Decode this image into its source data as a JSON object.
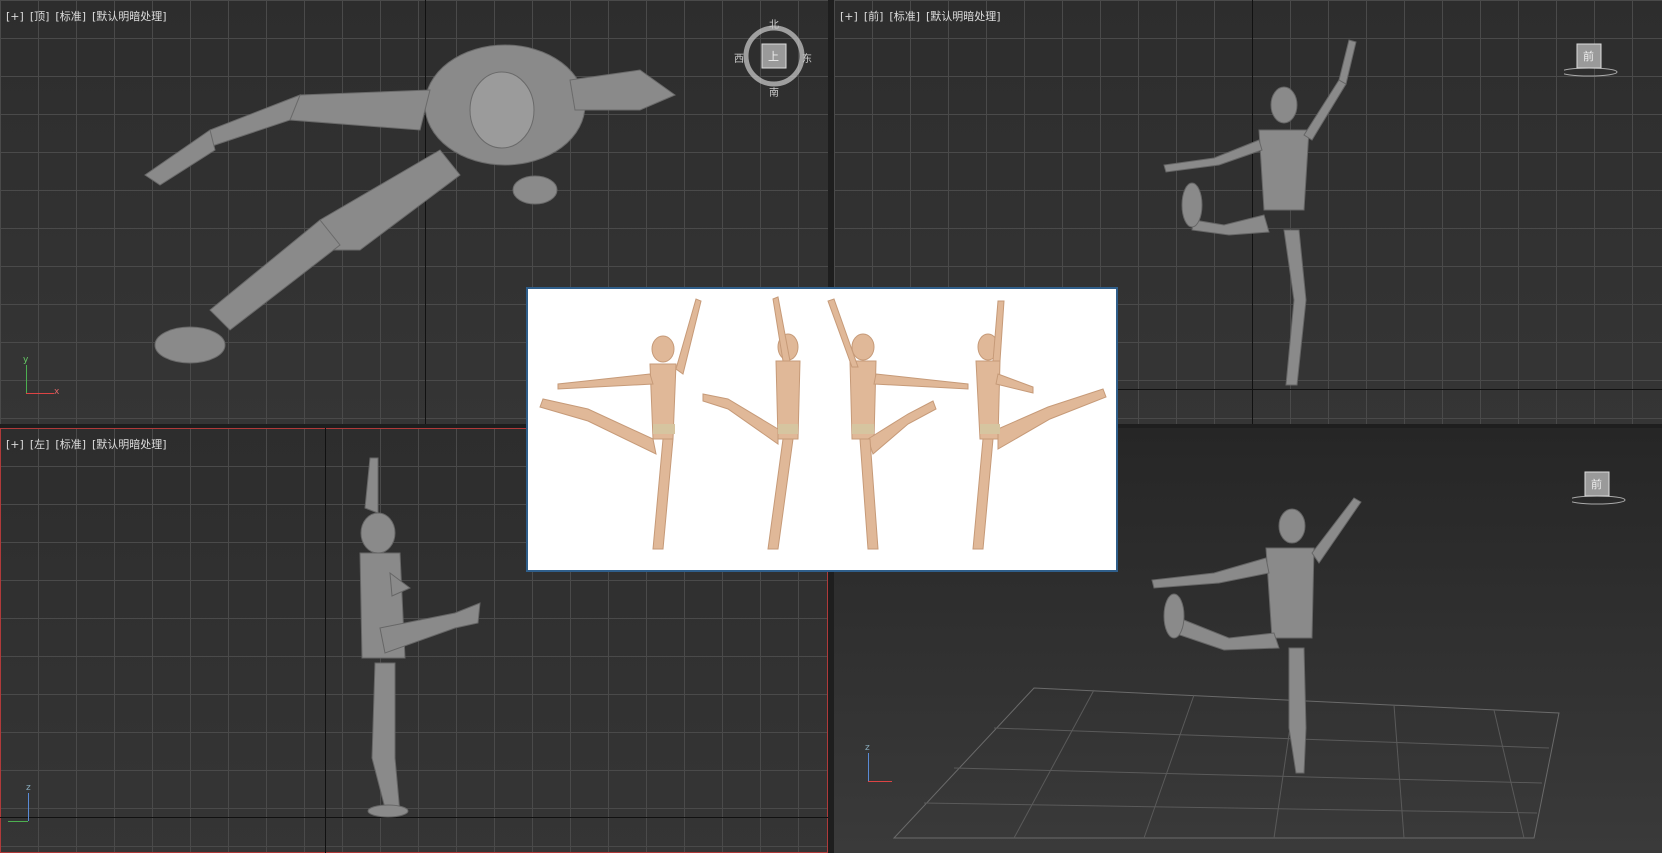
{
  "viewports": {
    "top": {
      "labels": [
        "[+]",
        "[顶]",
        "[标准]",
        "[默认明暗处理]"
      ]
    },
    "front": {
      "labels": [
        "[+]",
        "[前]",
        "[标准]",
        "[默认明暗处理]"
      ]
    },
    "left": {
      "labels": [
        "[+]",
        "[左]",
        "[标准]",
        "[默认明暗处理]"
      ]
    },
    "perspective": {
      "labels": []
    }
  },
  "compass": {
    "center": "上",
    "north": "北",
    "south": "南",
    "east": "东",
    "west": "西"
  },
  "viewcube_front_label": "前",
  "axis": {
    "x": "x",
    "y": "y",
    "z": "z"
  },
  "colors": {
    "active_border": "#b03a3a",
    "inset_border": "#2f5e8a",
    "grid": "#4a4a4a"
  }
}
